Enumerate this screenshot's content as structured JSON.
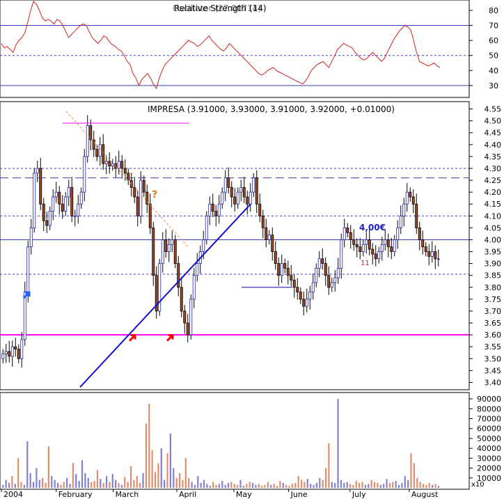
{
  "chart_data": [
    {
      "type": "line",
      "panel": "rsi",
      "title": "Relative Strength (14)",
      "overlay_text": "Oscillator (27.00714)",
      "y_ticks": [
        30,
        40,
        50,
        60,
        70,
        80
      ],
      "ylim": [
        23,
        86
      ],
      "reference_lines": [
        {
          "value": 70,
          "style": "solid",
          "color": "#3a3ab8"
        },
        {
          "value": 50,
          "style": "dashed",
          "color": "#3a3ab8"
        },
        {
          "value": 30,
          "style": "solid",
          "color": "#3a3ab8"
        }
      ],
      "series": [
        {
          "color": "#d02020",
          "values": [
            58,
            55,
            56,
            54,
            52,
            57,
            60,
            62,
            65,
            72,
            80,
            86,
            84,
            80,
            75,
            73,
            74,
            73,
            71,
            74,
            73,
            70,
            66,
            62,
            64,
            66,
            68,
            70,
            71,
            70,
            66,
            62,
            60,
            58,
            60,
            63,
            62,
            59,
            57,
            56,
            54,
            53,
            50,
            46,
            44,
            38,
            35,
            30,
            34,
            36,
            38,
            35,
            31,
            28,
            35,
            40,
            44,
            46,
            48,
            50,
            52,
            54,
            56,
            58,
            60,
            59,
            58,
            56,
            57,
            59,
            61,
            63,
            60,
            58,
            56,
            54,
            53,
            55,
            58,
            56,
            54,
            52,
            50,
            48,
            46,
            44,
            42,
            40,
            38,
            37,
            38,
            40,
            41,
            42,
            40,
            39,
            38,
            37,
            36,
            35,
            34,
            33,
            32,
            31,
            33,
            36,
            40,
            42,
            44,
            45,
            46,
            44,
            42,
            46,
            50,
            54,
            56,
            58,
            57,
            56,
            55,
            52,
            50,
            48,
            47,
            48,
            50,
            52,
            50,
            48,
            46,
            48,
            52,
            56,
            60,
            63,
            66,
            68,
            70,
            69,
            67,
            60,
            52,
            46,
            45,
            44,
            43,
            44,
            45,
            43,
            42
          ]
        }
      ]
    },
    {
      "type": "candlestick",
      "panel": "price",
      "title": "IMPRESA (3.91000, 3.93000, 3.91000, 3.92000, +0.01000)",
      "y_ticks": [
        3.4,
        3.45,
        3.5,
        3.55,
        3.6,
        3.65,
        3.7,
        3.75,
        3.8,
        3.85,
        3.9,
        3.95,
        4.0,
        4.05,
        4.1,
        4.15,
        4.2,
        4.25,
        4.3,
        4.35,
        4.4,
        4.45,
        4.5,
        4.55
      ],
      "ylim": [
        3.375,
        4.575
      ],
      "x_labels": [
        "2004",
        "February",
        "March",
        "April",
        "May",
        "June",
        "July",
        "August"
      ],
      "horizontal_lines": [
        {
          "value": 4.3,
          "style": "dashed",
          "color": "#3a3ab8"
        },
        {
          "value": 4.26,
          "style": "longdash",
          "color": "#3a3ab8"
        },
        {
          "value": 4.1,
          "style": "dashed",
          "color": "#3a3ab8"
        },
        {
          "value": 4.0,
          "style": "solid",
          "color": "#3a3ab8"
        },
        {
          "value": 3.855,
          "style": "dashed",
          "color": "#3a3ab8"
        },
        {
          "value": 3.6,
          "style": "solid",
          "color": "#ff00ff"
        }
      ],
      "annotations": [
        {
          "text": "?",
          "color": "#e07820"
        },
        {
          "text": "4,00€",
          "color": "#2020c0"
        },
        {
          "text": "11",
          "color": "#d02020"
        }
      ],
      "closes": [
        3.52,
        3.53,
        3.51,
        3.55,
        3.54,
        3.5,
        3.58,
        3.78,
        3.97,
        4.05,
        4.28,
        4.3,
        4.15,
        4.08,
        4.06,
        4.12,
        4.18,
        4.2,
        4.15,
        4.12,
        4.18,
        4.22,
        4.1,
        4.1,
        4.15,
        4.2,
        4.35,
        4.48,
        4.42,
        4.38,
        4.35,
        4.4,
        4.32,
        4.33,
        4.31,
        4.32,
        4.3,
        4.33,
        4.3,
        4.28,
        4.25,
        4.22,
        4.18,
        4.1,
        4.25,
        4.2,
        4.15,
        4.05,
        3.85,
        3.7,
        3.9,
        4.0,
        3.95,
        3.98,
        4.0,
        3.9,
        3.8,
        3.7,
        3.65,
        3.6,
        3.75,
        3.85,
        3.9,
        3.95,
        4.0,
        4.1,
        4.15,
        4.12,
        4.1,
        4.15,
        4.2,
        4.26,
        4.22,
        4.18,
        4.15,
        4.2,
        4.22,
        4.18,
        4.15,
        4.2,
        4.26,
        4.15,
        4.1,
        4.05,
        4.0,
        4.02,
        3.95,
        3.9,
        3.85,
        3.9,
        3.88,
        3.85,
        3.83,
        3.8,
        3.78,
        3.75,
        3.72,
        3.75,
        3.78,
        3.82,
        3.88,
        3.92,
        3.9,
        3.85,
        3.8,
        3.82,
        3.84,
        3.88,
        4.0,
        4.05,
        4.03,
        4.0,
        3.98,
        3.97,
        3.95,
        3.98,
        4.0,
        3.96,
        3.94,
        3.92,
        3.95,
        3.98,
        4.0,
        3.97,
        3.95,
        4.0,
        4.05,
        4.1,
        4.15,
        4.2,
        4.18,
        4.15,
        4.05,
        4.0,
        3.97,
        3.95,
        3.93,
        3.95,
        3.92,
        3.92
      ],
      "trendlines": [
        {
          "from": [
            "January",
            3.38
          ],
          "to": [
            "May",
            4.15
          ],
          "color": "#1010d0"
        },
        {
          "from": [
            "February",
            4.48
          ],
          "to": [
            "April",
            4.02
          ],
          "color": "#f08040",
          "style": "dashed"
        }
      ]
    },
    {
      "type": "bar",
      "panel": "volume",
      "y_ticks": [
        10000,
        20000,
        30000,
        40000,
        50000,
        60000,
        70000,
        80000,
        90000
      ],
      "ylim": [
        0,
        95000
      ],
      "unit_label": "x10",
      "values": [
        3000,
        8000,
        5000,
        12000,
        4000,
        30000,
        6000,
        3000,
        47000,
        15000,
        6000,
        20000,
        8000,
        10000,
        5000,
        42000,
        12000,
        8000,
        5000,
        3000,
        6000,
        10000,
        4000,
        25000,
        14000,
        7000,
        28000,
        15000,
        10000,
        6000,
        7000,
        18000,
        9000,
        5000,
        12000,
        6000,
        14000,
        8000,
        5000,
        3000,
        11000,
        6000,
        22000,
        8000,
        12000,
        5000,
        15000,
        65000,
        85000,
        38000,
        16000,
        25000,
        40000,
        8000,
        35000,
        55000,
        20000,
        10000,
        15000,
        8000,
        30000,
        10000,
        6000,
        3000,
        12000,
        5000,
        8000,
        4000,
        2000,
        6000,
        3000,
        4000,
        7000,
        3000,
        5000,
        6000,
        4000,
        3000,
        8000,
        2000,
        4000,
        6000,
        5000,
        3000,
        4000,
        2000,
        3000,
        6000,
        3000,
        4000,
        2000,
        7000,
        5000,
        3000,
        2000,
        4000,
        5000,
        12000,
        8000,
        6000,
        9000,
        4000,
        3000,
        5000,
        10000,
        8000,
        20000,
        45000,
        6000,
        5000,
        90000,
        8000,
        5000,
        6000,
        4000,
        3000,
        7000,
        5000,
        6000,
        3000,
        4000,
        8000,
        6000,
        5000,
        3000,
        4000,
        9000,
        5000,
        6000,
        7000,
        3000,
        5000,
        12000,
        8000,
        35000,
        25000,
        10000,
        6000,
        4000,
        3000,
        5000,
        3000,
        4000,
        2000
      ]
    }
  ],
  "labels": {
    "rsi_title": "Relative Strength (14)",
    "rsi_overlay": "Oscillator (27.00714)",
    "price_title": "IMPRESA (3.91000, 3.93000, 3.91000, 3.92000, +0.01000)",
    "question": "?",
    "euro_level": "4,00€",
    "count_label": "11",
    "vol_unit": "x10"
  }
}
